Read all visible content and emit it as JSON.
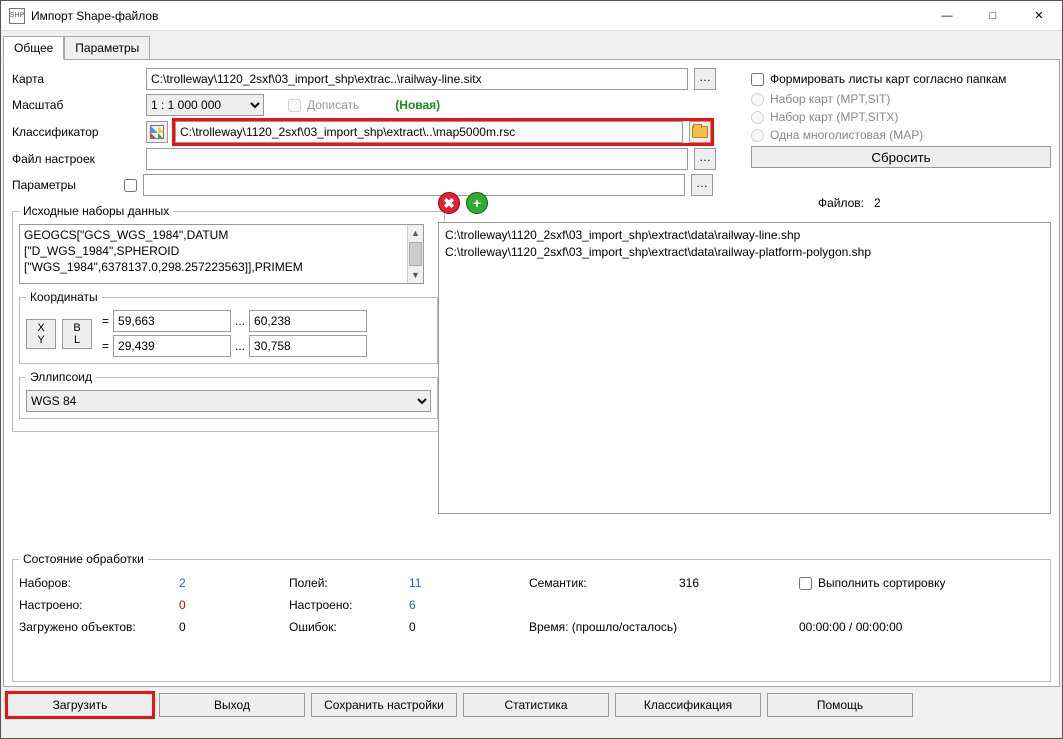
{
  "window": {
    "title": "Импорт Shape-файлов",
    "app_icon_text": "SHP"
  },
  "tabs": {
    "general": "Общее",
    "params": "Параметры"
  },
  "labels": {
    "map": "Карта",
    "scale": "Масштаб",
    "classifier": "Классификатор",
    "settings_file": "Файл настроек",
    "parameters": "Параметры",
    "append": "Дописать",
    "new_flag": "(Новая)"
  },
  "fields": {
    "map_path": "C:\\trolleway\\1120_2sxf\\03_import_shp\\extrac..\\railway-line.sitx",
    "scale": "1 : 1 000 000",
    "classifier_path": "C:\\trolleway\\1120_2sxf\\03_import_shp\\extract\\..\\map5000m.rsc",
    "settings_file_path": "",
    "parameters_value": ""
  },
  "right_panel": {
    "form_sheets": "Формировать листы карт согласно папкам",
    "radio1": "Набор карт (MPT,SIT)",
    "radio2": "Набор карт (MPT,SITX)",
    "radio3": "Одна многолистовая (MAP)",
    "reset": "Сбросить"
  },
  "datasets": {
    "legend": "Исходные наборы данных",
    "text_l1": "GEOGCS[\"GCS_WGS_1984\",DATUM",
    "text_l2": "[\"D_WGS_1984\",SPHEROID",
    "text_l3": "[\"WGS_1984\",6378137.0,298.257223563]],PRIMEM",
    "coords_legend": "Координаты",
    "xy": "X\nY",
    "bl": "B\nL",
    "eq": "=",
    "x1": "59,663",
    "x2": "60,238",
    "y1": "29,439",
    "y2": "30,758",
    "dots": "...",
    "ellips_legend": "Эллипсоид",
    "ellipsoid": "WGS 84"
  },
  "filepanel": {
    "files_label": "Файлов:",
    "files_count": "2",
    "files": [
      "C:\\trolleway\\1120_2sxf\\03_import_shp\\extract\\data\\railway-line.shp",
      "C:\\trolleway\\1120_2sxf\\03_import_shp\\extract\\data\\railway-platform-polygon.shp"
    ]
  },
  "status": {
    "legend": "Состояние обработки",
    "sets_lbl": "Наборов:",
    "sets_val": "2",
    "fields_lbl": "Полей:",
    "fields_val": "11",
    "sem_lbl": "Семантик:",
    "sem_val": "316",
    "sort_lbl": "Выполнить сортировку",
    "tuned_lbl": "Настроено:",
    "tuned_val": "0",
    "tuned2_lbl": "Настроено:",
    "tuned2_val": "6",
    "loaded_lbl": "Загружено объектов:",
    "loaded_val": "0",
    "err_lbl": "Ошибок:",
    "err_val": "0",
    "time_lbl": "Время: (прошло/осталось)",
    "time_val": "00:00:00 / 00:00:00"
  },
  "buttons": {
    "load": "Загрузить",
    "exit": "Выход",
    "save_settings": "Сохранить настройки",
    "stats": "Статистика",
    "classification": "Классификация",
    "help": "Помощь"
  }
}
